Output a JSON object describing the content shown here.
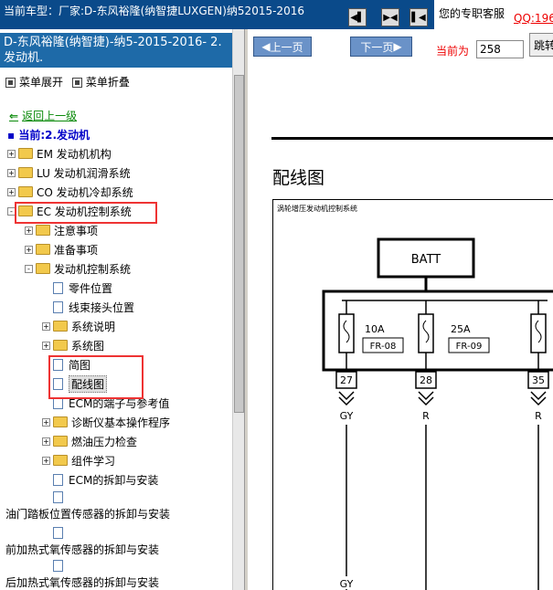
{
  "header": {
    "car_model": "当前车型：厂家:D-东风裕隆(纳智捷LUXGEN)纳52015-2016",
    "nav_icons": [
      "first-page-icon",
      "two-pane-icon",
      "prev-pane-icon"
    ],
    "service_label": "您的专职客服",
    "qq_text": "QQ:196"
  },
  "left": {
    "title": "D-东风裕隆(纳智捷)-纳5-2015-2016- 2.发动机.",
    "expand_menu": "菜单展开",
    "collapse_menu": "菜单折叠",
    "back_label": "返回上一级",
    "current_label": "当前:2.发动机",
    "tree": [
      {
        "label": "EM 发动机机构",
        "type": "folder",
        "pm": "+",
        "indent": 0
      },
      {
        "label": "LU 发动机润滑系统",
        "type": "folder",
        "pm": "+",
        "indent": 0
      },
      {
        "label": "CO 发动机冷却系统",
        "type": "folder",
        "pm": "+",
        "indent": 0
      },
      {
        "label": "EC 发动机控制系统",
        "type": "folder",
        "pm": "-",
        "indent": 0
      },
      {
        "label": "注意事项",
        "type": "folder",
        "pm": "+",
        "indent": 1
      },
      {
        "label": "准备事项",
        "type": "folder",
        "pm": "+",
        "indent": 1
      },
      {
        "label": "发动机控制系统",
        "type": "folder",
        "pm": "-",
        "indent": 1
      },
      {
        "label": "零件位置",
        "type": "page",
        "pm": "",
        "indent": 2
      },
      {
        "label": "线束接头位置",
        "type": "page",
        "pm": "",
        "indent": 2
      },
      {
        "label": "系统说明",
        "type": "folder",
        "pm": "+",
        "indent": 2
      },
      {
        "label": "系统图",
        "type": "folder",
        "pm": "+",
        "indent": 2
      },
      {
        "label": "简图",
        "type": "page",
        "pm": "",
        "indent": 2
      },
      {
        "label": "配线图",
        "type": "page",
        "pm": "",
        "indent": 2
      },
      {
        "label": "ECM的端子与参考值",
        "type": "page",
        "pm": "",
        "indent": 2
      },
      {
        "label": "诊断仪基本操作程序",
        "type": "folder",
        "pm": "+",
        "indent": 2
      },
      {
        "label": "燃油压力检查",
        "type": "folder",
        "pm": "+",
        "indent": 2
      },
      {
        "label": "组件学习",
        "type": "folder",
        "pm": "+",
        "indent": 2
      },
      {
        "label": "ECM的拆卸与安装",
        "type": "page",
        "pm": "",
        "indent": 2
      }
    ],
    "extra": [
      "油门踏板位置传感器的拆卸与安装",
      "前加热式氧传感器的拆卸与安装",
      "后加热式氧传感器的拆卸与安装"
    ]
  },
  "right": {
    "prev_label": "上一页",
    "next_label": "下一页",
    "current_page_label": "当前为",
    "current_page_value": "258",
    "jump_label": "跳转",
    "page_title": "配线图",
    "diagram": {
      "caption": "涡轮增压发动机控制系统",
      "batt": "BATT",
      "fuses": [
        {
          "amp": "10A",
          "code": "FR-08"
        },
        {
          "amp": "25A",
          "code": "FR-09"
        }
      ],
      "pins": [
        "27",
        "28",
        "35"
      ],
      "wires": [
        "GY",
        "R",
        "R"
      ],
      "bottom_wire": "GY"
    }
  },
  "colors": {
    "title_bg": "#1e6aa8",
    "header_bg": "#0a4a8a",
    "highlight": "#e33333",
    "button": "#6a92c8"
  }
}
